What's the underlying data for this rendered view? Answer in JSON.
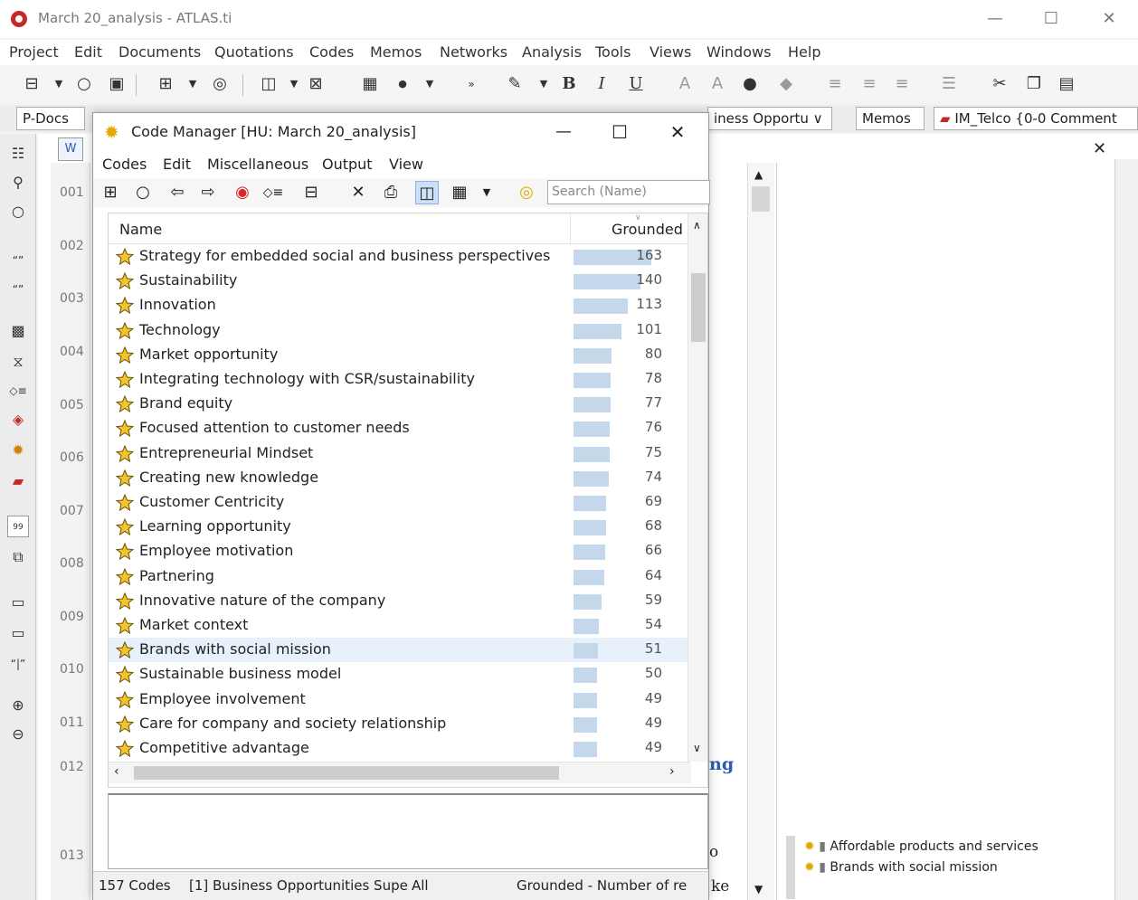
{
  "window": {
    "title": "March 20_analysis - ATLAS.ti",
    "controls": [
      "—",
      "☐",
      "✕"
    ]
  },
  "menu": [
    "Project",
    "Edit",
    "Documents",
    "Quotations",
    "Codes",
    "Memos",
    "Networks",
    "Analysis",
    "Tools",
    "Views",
    "Windows",
    "Help"
  ],
  "docbar": {
    "pdocs_label": "P-Docs",
    "code_filter": "iness Opportu",
    "memos_label": "Memos",
    "memo_select": "IM_Telco {0-0 Comment"
  },
  "line_numbers": [
    "001",
    "002",
    "003",
    "004",
    "005",
    "006",
    "007",
    "008",
    "009",
    "010",
    "011",
    "012",
    "013"
  ],
  "document_fragments": {
    "frag_ng": "ng",
    "frag_o": "o",
    "frag_ke": "ke"
  },
  "margin_codes": [
    {
      "label": "Affordable products and services"
    },
    {
      "label": "Brands with social mission"
    }
  ],
  "code_manager": {
    "title": "Code Manager [HU: March 20_analysis]",
    "menu": [
      "Codes",
      "Edit",
      "Miscellaneous",
      "Output",
      "View"
    ],
    "search_placeholder": "Search (Name)",
    "columns": {
      "name": "Name",
      "grounded": "Grounded"
    },
    "max_grounded": 163,
    "rows": [
      {
        "name": "Strategy for embedded social and business perspectives",
        "grounded": 163
      },
      {
        "name": "Sustainability",
        "grounded": 140
      },
      {
        "name": "Innovation",
        "grounded": 113
      },
      {
        "name": "Technology",
        "grounded": 101
      },
      {
        "name": "Market opportunity",
        "grounded": 80
      },
      {
        "name": "Integrating technology with CSR/sustainability",
        "grounded": 78
      },
      {
        "name": "Brand equity",
        "grounded": 77
      },
      {
        "name": "Focused attention to customer needs",
        "grounded": 76
      },
      {
        "name": "Entrepreneurial Mindset",
        "grounded": 75
      },
      {
        "name": "Creating new knowledge",
        "grounded": 74
      },
      {
        "name": "Customer Centricity",
        "grounded": 69
      },
      {
        "name": "Learning opportunity",
        "grounded": 68
      },
      {
        "name": "Employee motivation",
        "grounded": 66
      },
      {
        "name": "Partnering",
        "grounded": 64
      },
      {
        "name": "Innovative nature of the company",
        "grounded": 59
      },
      {
        "name": "Market context",
        "grounded": 54
      },
      {
        "name": "Brands with social mission",
        "grounded": 51,
        "selected": true
      },
      {
        "name": "Sustainable business model",
        "grounded": 50
      },
      {
        "name": "Employee involvement",
        "grounded": 49
      },
      {
        "name": "Care for company and society relationship",
        "grounded": 49
      },
      {
        "name": "Competitive advantage",
        "grounded": 49
      }
    ],
    "status": {
      "count": "157 Codes",
      "filter": "[1] Business Opportunities Supe",
      "scope": "All",
      "sort": "Grounded - Number of re"
    }
  },
  "colors": {
    "bar": "#c5d7eb",
    "selected_row": "#e8f1fb",
    "code_icon": "#e0a800",
    "atlas_logo": "#c62828"
  },
  "icons": [
    "code-star-icon",
    "close-icon",
    "search-icon",
    "print-icon",
    "scissors-icon"
  ]
}
